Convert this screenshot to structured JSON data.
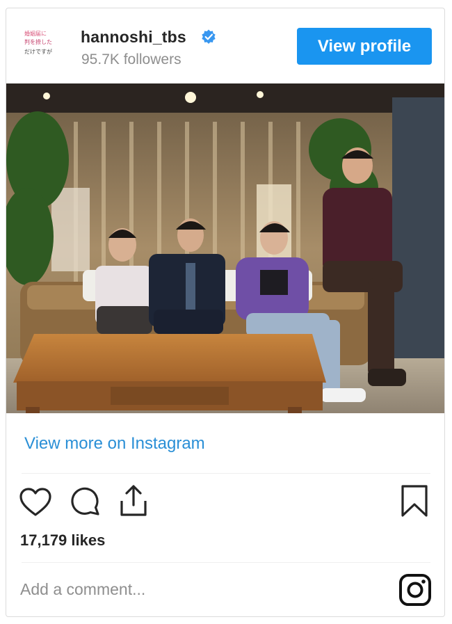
{
  "header": {
    "account_name": "hannoshi_tbs",
    "followers": "95.7K followers",
    "view_profile_label": "View profile",
    "avatar_lines": [
      "婚姻届に",
      "判を捺した",
      "だけですが"
    ]
  },
  "post": {
    "image_alt": "Four men posing on a wicker sofa behind a wooden coffee table in a dim room with curtains and plants",
    "view_more_label": "View more on Instagram",
    "likes": "17,179 likes",
    "comment_placeholder": "Add a comment..."
  },
  "icons": [
    "verified-badge-icon",
    "heart-icon",
    "comment-icon",
    "share-icon",
    "bookmark-icon",
    "instagram-icon"
  ],
  "colors": {
    "accent": "#1a95f0",
    "link": "#2a8fd6",
    "muted": "#8e8e8e",
    "text": "#262626",
    "border": "#dbdbdb"
  }
}
